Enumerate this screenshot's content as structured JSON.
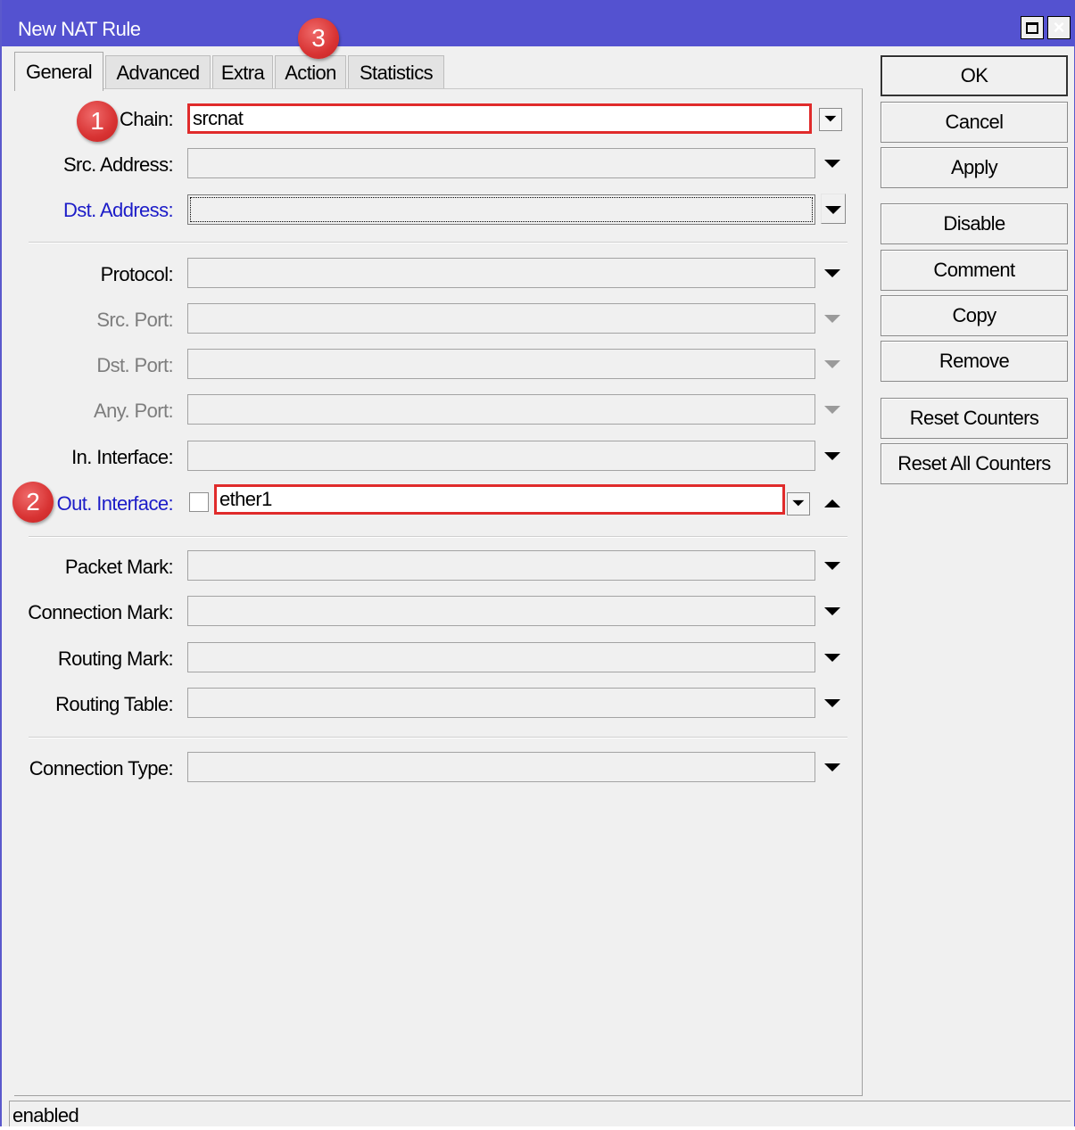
{
  "window": {
    "title": "New NAT Rule"
  },
  "tabs": [
    {
      "label": "General",
      "active": true
    },
    {
      "label": "Advanced",
      "active": false
    },
    {
      "label": "Extra",
      "active": false
    },
    {
      "label": "Action",
      "active": false
    },
    {
      "label": "Statistics",
      "active": false
    }
  ],
  "badges": {
    "chain": "1",
    "out_interface": "2",
    "action_tab": "3"
  },
  "form": {
    "chain": {
      "label": "Chain:",
      "value": "srcnat"
    },
    "src_address": {
      "label": "Src. Address:",
      "value": ""
    },
    "dst_address": {
      "label": "Dst. Address:",
      "value": ""
    },
    "protocol": {
      "label": "Protocol:",
      "value": ""
    },
    "src_port": {
      "label": "Src. Port:",
      "value": ""
    },
    "dst_port": {
      "label": "Dst. Port:",
      "value": ""
    },
    "any_port": {
      "label": "Any. Port:",
      "value": ""
    },
    "in_interface": {
      "label": "In. Interface:",
      "value": ""
    },
    "out_interface": {
      "label": "Out. Interface:",
      "value": "ether1",
      "negate": false
    },
    "packet_mark": {
      "label": "Packet Mark:",
      "value": ""
    },
    "connection_mark": {
      "label": "Connection Mark:",
      "value": ""
    },
    "routing_mark": {
      "label": "Routing Mark:",
      "value": ""
    },
    "routing_table": {
      "label": "Routing Table:",
      "value": ""
    },
    "connection_type": {
      "label": "Connection Type:",
      "value": ""
    }
  },
  "buttons": {
    "ok": "OK",
    "cancel": "Cancel",
    "apply": "Apply",
    "disable": "Disable",
    "comment": "Comment",
    "copy": "Copy",
    "remove": "Remove",
    "reset_counters": "Reset Counters",
    "reset_all_counters": "Reset All Counters"
  },
  "status": "enabled",
  "colors": {
    "titlebar": "#5452d0",
    "highlight": "#e02b2b",
    "link_label": "#1c1cc8"
  }
}
